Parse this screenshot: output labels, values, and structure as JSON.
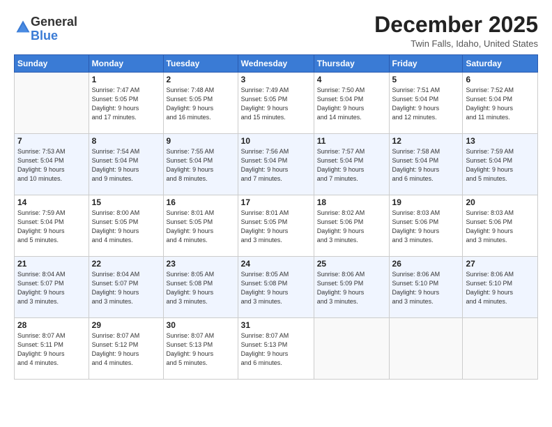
{
  "logo": {
    "general": "General",
    "blue": "Blue"
  },
  "title": "December 2025",
  "location": "Twin Falls, Idaho, United States",
  "days_of_week": [
    "Sunday",
    "Monday",
    "Tuesday",
    "Wednesday",
    "Thursday",
    "Friday",
    "Saturday"
  ],
  "weeks": [
    [
      {
        "day": "",
        "info": ""
      },
      {
        "day": "1",
        "info": "Sunrise: 7:47 AM\nSunset: 5:05 PM\nDaylight: 9 hours\nand 17 minutes."
      },
      {
        "day": "2",
        "info": "Sunrise: 7:48 AM\nSunset: 5:05 PM\nDaylight: 9 hours\nand 16 minutes."
      },
      {
        "day": "3",
        "info": "Sunrise: 7:49 AM\nSunset: 5:05 PM\nDaylight: 9 hours\nand 15 minutes."
      },
      {
        "day": "4",
        "info": "Sunrise: 7:50 AM\nSunset: 5:04 PM\nDaylight: 9 hours\nand 14 minutes."
      },
      {
        "day": "5",
        "info": "Sunrise: 7:51 AM\nSunset: 5:04 PM\nDaylight: 9 hours\nand 12 minutes."
      },
      {
        "day": "6",
        "info": "Sunrise: 7:52 AM\nSunset: 5:04 PM\nDaylight: 9 hours\nand 11 minutes."
      }
    ],
    [
      {
        "day": "7",
        "info": "Sunrise: 7:53 AM\nSunset: 5:04 PM\nDaylight: 9 hours\nand 10 minutes."
      },
      {
        "day": "8",
        "info": "Sunrise: 7:54 AM\nSunset: 5:04 PM\nDaylight: 9 hours\nand 9 minutes."
      },
      {
        "day": "9",
        "info": "Sunrise: 7:55 AM\nSunset: 5:04 PM\nDaylight: 9 hours\nand 8 minutes."
      },
      {
        "day": "10",
        "info": "Sunrise: 7:56 AM\nSunset: 5:04 PM\nDaylight: 9 hours\nand 7 minutes."
      },
      {
        "day": "11",
        "info": "Sunrise: 7:57 AM\nSunset: 5:04 PM\nDaylight: 9 hours\nand 7 minutes."
      },
      {
        "day": "12",
        "info": "Sunrise: 7:58 AM\nSunset: 5:04 PM\nDaylight: 9 hours\nand 6 minutes."
      },
      {
        "day": "13",
        "info": "Sunrise: 7:59 AM\nSunset: 5:04 PM\nDaylight: 9 hours\nand 5 minutes."
      }
    ],
    [
      {
        "day": "14",
        "info": "Sunrise: 7:59 AM\nSunset: 5:04 PM\nDaylight: 9 hours\nand 5 minutes."
      },
      {
        "day": "15",
        "info": "Sunrise: 8:00 AM\nSunset: 5:05 PM\nDaylight: 9 hours\nand 4 minutes."
      },
      {
        "day": "16",
        "info": "Sunrise: 8:01 AM\nSunset: 5:05 PM\nDaylight: 9 hours\nand 4 minutes."
      },
      {
        "day": "17",
        "info": "Sunrise: 8:01 AM\nSunset: 5:05 PM\nDaylight: 9 hours\nand 3 minutes."
      },
      {
        "day": "18",
        "info": "Sunrise: 8:02 AM\nSunset: 5:06 PM\nDaylight: 9 hours\nand 3 minutes."
      },
      {
        "day": "19",
        "info": "Sunrise: 8:03 AM\nSunset: 5:06 PM\nDaylight: 9 hours\nand 3 minutes."
      },
      {
        "day": "20",
        "info": "Sunrise: 8:03 AM\nSunset: 5:06 PM\nDaylight: 9 hours\nand 3 minutes."
      }
    ],
    [
      {
        "day": "21",
        "info": "Sunrise: 8:04 AM\nSunset: 5:07 PM\nDaylight: 9 hours\nand 3 minutes."
      },
      {
        "day": "22",
        "info": "Sunrise: 8:04 AM\nSunset: 5:07 PM\nDaylight: 9 hours\nand 3 minutes."
      },
      {
        "day": "23",
        "info": "Sunrise: 8:05 AM\nSunset: 5:08 PM\nDaylight: 9 hours\nand 3 minutes."
      },
      {
        "day": "24",
        "info": "Sunrise: 8:05 AM\nSunset: 5:08 PM\nDaylight: 9 hours\nand 3 minutes."
      },
      {
        "day": "25",
        "info": "Sunrise: 8:06 AM\nSunset: 5:09 PM\nDaylight: 9 hours\nand 3 minutes."
      },
      {
        "day": "26",
        "info": "Sunrise: 8:06 AM\nSunset: 5:10 PM\nDaylight: 9 hours\nand 3 minutes."
      },
      {
        "day": "27",
        "info": "Sunrise: 8:06 AM\nSunset: 5:10 PM\nDaylight: 9 hours\nand 4 minutes."
      }
    ],
    [
      {
        "day": "28",
        "info": "Sunrise: 8:07 AM\nSunset: 5:11 PM\nDaylight: 9 hours\nand 4 minutes."
      },
      {
        "day": "29",
        "info": "Sunrise: 8:07 AM\nSunset: 5:12 PM\nDaylight: 9 hours\nand 4 minutes."
      },
      {
        "day": "30",
        "info": "Sunrise: 8:07 AM\nSunset: 5:13 PM\nDaylight: 9 hours\nand 5 minutes."
      },
      {
        "day": "31",
        "info": "Sunrise: 8:07 AM\nSunset: 5:13 PM\nDaylight: 9 hours\nand 6 minutes."
      },
      {
        "day": "",
        "info": ""
      },
      {
        "day": "",
        "info": ""
      },
      {
        "day": "",
        "info": ""
      }
    ]
  ]
}
